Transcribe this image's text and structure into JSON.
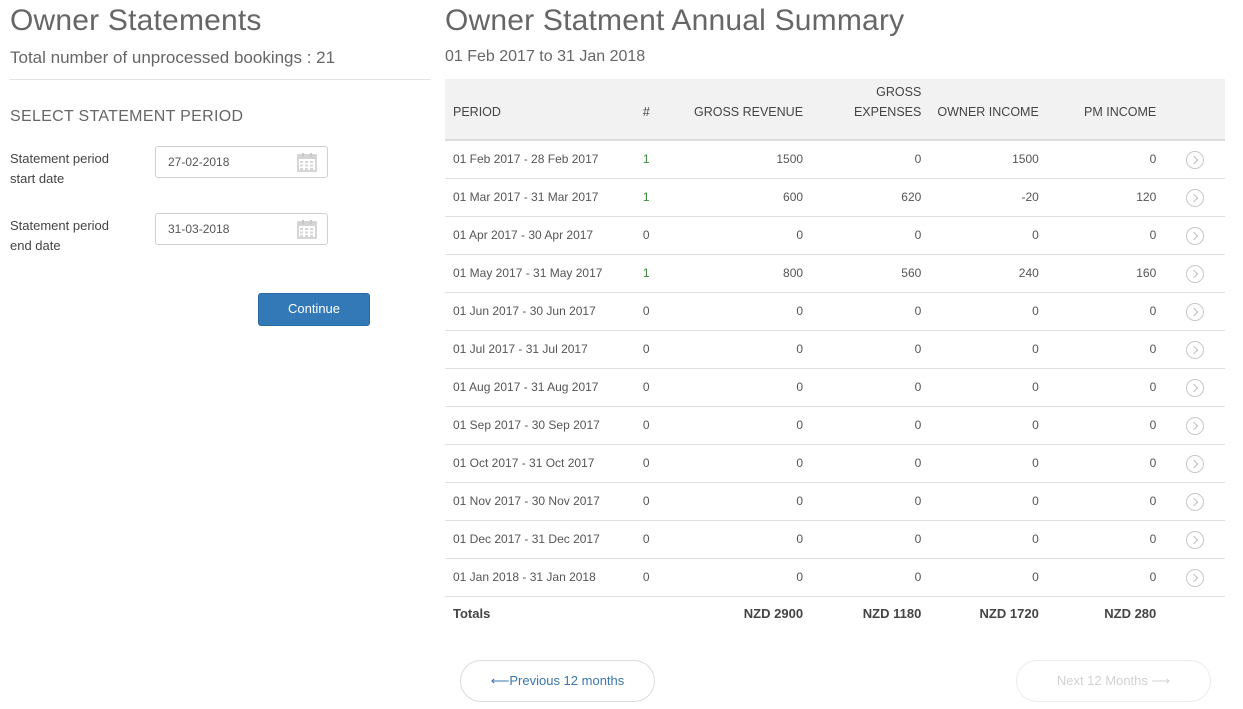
{
  "left": {
    "title": "Owner Statements",
    "unprocessed": "Total number of unprocessed bookings : 21",
    "section_title": "SELECT STATEMENT PERIOD",
    "start_label_1": "Statement period",
    "start_label_2": "start date",
    "start_value": "27-02-2018",
    "end_label_1": "Statement period",
    "end_label_2": "end date",
    "end_value": "31-03-2018",
    "continue_label": "Continue",
    "calendar_icon": "calendar-icon"
  },
  "right": {
    "title": "Owner Statment Annual Summary",
    "date_range": "01 Feb 2017 to 31 Jan 2018",
    "headers": {
      "period": "PERIOD",
      "count": "#",
      "gross_revenue": "GROSS REVENUE",
      "gross_expenses_1": "GROSS",
      "gross_expenses_2": "EXPENSES",
      "owner_income": "OWNER INCOME",
      "pm_income": "PM INCOME"
    },
    "rows": [
      {
        "period": "01 Feb 2017 - 28 Feb 2017",
        "count": "1",
        "gross_revenue": "1500",
        "gross_expenses": "0",
        "owner_income": "1500",
        "pm_income": "0"
      },
      {
        "period": "01 Mar 2017 - 31 Mar 2017",
        "count": "1",
        "gross_revenue": "600",
        "gross_expenses": "620",
        "owner_income": "-20",
        "pm_income": "120"
      },
      {
        "period": "01 Apr 2017 - 30 Apr 2017",
        "count": "0",
        "gross_revenue": "0",
        "gross_expenses": "0",
        "owner_income": "0",
        "pm_income": "0"
      },
      {
        "period": "01 May 2017 - 31 May 2017",
        "count": "1",
        "gross_revenue": "800",
        "gross_expenses": "560",
        "owner_income": "240",
        "pm_income": "160"
      },
      {
        "period": "01 Jun 2017 - 30 Jun 2017",
        "count": "0",
        "gross_revenue": "0",
        "gross_expenses": "0",
        "owner_income": "0",
        "pm_income": "0"
      },
      {
        "period": "01 Jul 2017 - 31 Jul 2017",
        "count": "0",
        "gross_revenue": "0",
        "gross_expenses": "0",
        "owner_income": "0",
        "pm_income": "0"
      },
      {
        "period": "01 Aug 2017 - 31 Aug 2017",
        "count": "0",
        "gross_revenue": "0",
        "gross_expenses": "0",
        "owner_income": "0",
        "pm_income": "0"
      },
      {
        "period": "01 Sep 2017 - 30 Sep 2017",
        "count": "0",
        "gross_revenue": "0",
        "gross_expenses": "0",
        "owner_income": "0",
        "pm_income": "0"
      },
      {
        "period": "01 Oct 2017 - 31 Oct 2017",
        "count": "0",
        "gross_revenue": "0",
        "gross_expenses": "0",
        "owner_income": "0",
        "pm_income": "0"
      },
      {
        "period": "01 Nov 2017 - 30 Nov 2017",
        "count": "0",
        "gross_revenue": "0",
        "gross_expenses": "0",
        "owner_income": "0",
        "pm_income": "0"
      },
      {
        "period": "01 Dec 2017 - 31 Dec 2017",
        "count": "0",
        "gross_revenue": "0",
        "gross_expenses": "0",
        "owner_income": "0",
        "pm_income": "0"
      },
      {
        "period": "01 Jan 2018 - 31 Jan 2018",
        "count": "0",
        "gross_revenue": "0",
        "gross_expenses": "0",
        "owner_income": "0",
        "pm_income": "0"
      }
    ],
    "totals": {
      "label": "Totals",
      "gross_revenue": "NZD 2900",
      "gross_expenses": "NZD 1180",
      "owner_income": "NZD 1720",
      "pm_income": "NZD 280"
    },
    "prev_label": "⟵Previous 12 months",
    "next_label": "Next 12 Months ⟶",
    "count_link_color": "#3b8a3b",
    "row_icon": "chevron-right-circle-icon"
  }
}
